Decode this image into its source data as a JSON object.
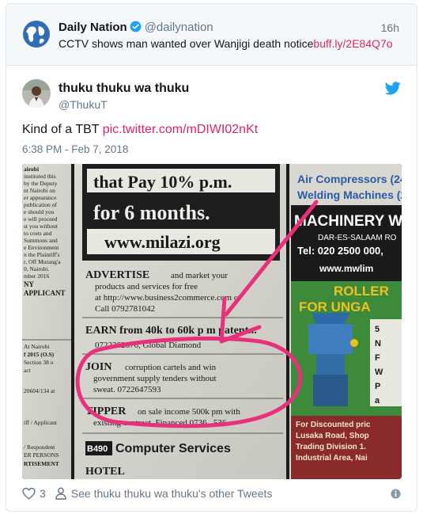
{
  "quoted": {
    "name": "Daily Nation",
    "handle": "@dailynation",
    "time": "16h",
    "text": "CCTV shows man wanted over Wanjigi death notice",
    "link": "buff.ly/2E84Q7o",
    "avatar_icon": "globe-icon",
    "verified_icon": "verified-badge-icon"
  },
  "tweet": {
    "name": "thuku thuku wa thuku",
    "handle": "@ThukuT",
    "text": "Kind of a TBT",
    "link": "pic.twitter.com/mDIWI02nKt",
    "timestamp": "6:38 PM - Feb 7, 2018",
    "brand_icon": "twitter-bird-icon"
  },
  "newspaper": {
    "left_col_lines": [
      "airobi",
      "instituted this",
      "by the Deputy",
      "nt Nairobi on",
      "er appearance",
      "publication of",
      "e should you",
      "e will proceed",
      "st you without",
      "to costs and",
      "Summons and",
      "e Environment",
      "n the Plaintiff's",
      "r, Off Murang'a",
      "0, Nairobi.",
      "mber 2016",
      "NY",
      "APPLICANT"
    ],
    "left_col_lines_b": [
      "At Nairobi",
      "f 2015 (O.S)",
      "Section 38 o",
      "act",
      "",
      "20604/134 at",
      "",
      "iff / Applicant",
      "",
      "/ Respondent",
      "ER PERSONS",
      "RTISEMENT"
    ],
    "banner_line1": "that Pay 10% p.m.",
    "banner_line2": "for 6 months.",
    "banner_url": "www.milazi.org",
    "ad_advertise_head": "ADVERTISE",
    "ad_advertise_text": "and market your products and services for free at http://www.business2commerce.com or Call 0792781042",
    "ad_earn": "EARN from 40k to 60k p m patent...",
    "ad_earn_2": "0722362676, Global Diamond",
    "ad_join_head": "JOIN",
    "ad_join_text": "corruption cartels and win government supply tenders without sweat. 0722647593",
    "ad_tipper_head": "TIPPER",
    "ad_tipper_text": "on sale income 500k pm with existing contract, Financed 0736...536",
    "ad_b490": "B490 Computer Services",
    "ad_hotel": "HOTEL",
    "right_head1": "Air Compressors (24l",
    "right_head2": "Welding Machines (2",
    "right_brand": "MACHINERY W",
    "right_addr": "DAR-ES-SALAAM RO",
    "right_tel": "Tel: 020 2500 000,",
    "right_web": "www.mwlim",
    "roller_1": "ROLLER",
    "roller_2": "FOR UNGA",
    "right_bullets": [
      "5",
      "N",
      "F",
      "W",
      "P",
      "a"
    ],
    "right_foot": [
      "For Discounted pric",
      "Lusaka Road, Shop",
      "Trading Division 1.",
      "Industrial Area, Nai"
    ]
  },
  "footer": {
    "likes": "3",
    "other_tweets": "See thuku thuku wa thuku's other Tweets",
    "heart_icon": "heart-icon",
    "person_icon": "person-icon",
    "info_icon": "info-icon"
  },
  "colors": {
    "link": "#e0245e",
    "twitter_blue": "#1da1f2",
    "secondary_text": "#657786",
    "marker": "#e8317a"
  }
}
